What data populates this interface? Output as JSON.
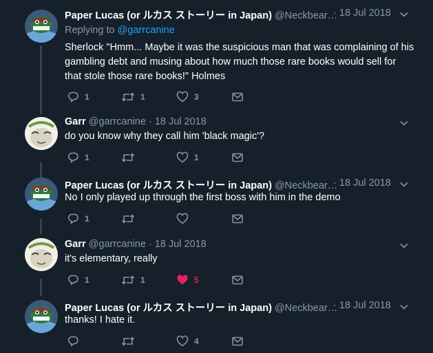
{
  "tweets": [
    {
      "name": "Paper Lucas (or ルカス ストーリー in Japan)",
      "handle": "@Neckbear…",
      "dot": "·",
      "date": "18 Jul 2018",
      "replying_prefix": "Replying to ",
      "replying_handle": "@garrcanine",
      "lines": [
        "Sherlock \"Hmm... Maybe it was the suspicious man that was complaining of his",
        "gambling debt and musing about how much those rare books would sell for",
        "that stole those rare books!\" Holmes"
      ],
      "replies": "1",
      "retweets": "1",
      "likes": "3",
      "liked": false,
      "avatar": "lucas"
    },
    {
      "name": "Garr",
      "handle": "@garrcanine",
      "dot": "·",
      "date": "18 Jul 2018",
      "lines": [
        "do you know why they call him 'black magic'?"
      ],
      "replies": "1",
      "retweets": "",
      "likes": "1",
      "liked": false,
      "avatar": "garr"
    },
    {
      "name": "Paper Lucas (or ルカス ストーリー in Japan)",
      "handle": "@Neckbear…",
      "dot": "·",
      "date": "18 Jul 2018",
      "lines": [
        "No I only played up through the first boss with him in the demo"
      ],
      "replies": "1",
      "retweets": "",
      "likes": "",
      "liked": false,
      "avatar": "lucas"
    },
    {
      "name": "Garr",
      "handle": "@garrcanine",
      "dot": "·",
      "date": "18 Jul 2018",
      "lines": [
        "it's elementary, really"
      ],
      "replies": "1",
      "retweets": "1",
      "likes": "5",
      "liked": true,
      "avatar": "garr"
    },
    {
      "name": "Paper Lucas (or ルカス ストーリー in Japan)",
      "handle": "@Neckbear…",
      "dot": "·",
      "date": "18 Jul 2018",
      "lines": [
        "thanks! I hate it."
      ],
      "replies": "",
      "retweets": "",
      "likes": "4",
      "liked": false,
      "avatar": "lucas"
    }
  ],
  "colors": {
    "background": "#15202b",
    "secondary_text": "#8899a6",
    "link": "#1da1f2",
    "like_active": "#e0245e",
    "thread_line": "#38444d"
  },
  "icons": [
    "reply-icon",
    "retweet-icon",
    "heart-icon",
    "message-icon",
    "chevron-down-icon"
  ]
}
